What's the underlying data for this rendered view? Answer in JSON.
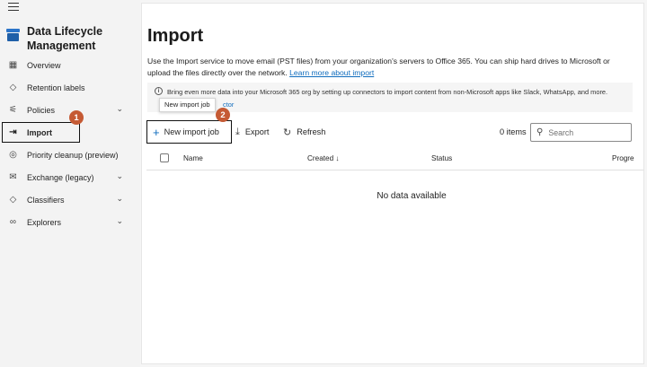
{
  "app": {
    "title": "Data Lifecycle Management"
  },
  "sidebar": {
    "items": [
      {
        "label": "Overview",
        "icon": "overview-icon"
      },
      {
        "label": "Retention labels",
        "icon": "tag-icon"
      },
      {
        "label": "Policies",
        "icon": "sliders-icon",
        "expandable": true
      },
      {
        "label": "Import",
        "icon": "import-icon",
        "active": true
      },
      {
        "label": "Priority cleanup (preview)",
        "icon": "cleanup-icon"
      },
      {
        "label": "Exchange (legacy)",
        "icon": "mail-icon",
        "expandable": true
      },
      {
        "label": "Classifiers",
        "icon": "tag-icon",
        "expandable": true
      },
      {
        "label": "Explorers",
        "icon": "glasses-icon",
        "expandable": true
      }
    ]
  },
  "callouts": {
    "step1": "1",
    "step2": "2"
  },
  "main": {
    "title": "Import",
    "description": "Use the Import service to move email (PST files) from your organization's servers to Office 365. You can ship hard drives to Microsoft or upload the files directly over the network.",
    "learn_more": "Learn more about import",
    "info_text": "Bring even more data into your Microsoft 365 org by setting up connectors to import content from non-Microsoft apps like Slack, WhatsApp, and more.",
    "info_link_fragment": "ctor",
    "tooltip": "New import job",
    "toolbar": {
      "new_job": "New import job",
      "export": "Export",
      "refresh": "Refresh",
      "items_count": "0 items",
      "search_placeholder": "Search"
    },
    "table": {
      "columns": [
        "Name",
        "Created",
        "Status",
        "Progre"
      ],
      "sort_indicator": "↓",
      "empty_text": "No data available"
    }
  },
  "colors": {
    "accent": "#0f6cbd",
    "badge": "#c55a34"
  }
}
